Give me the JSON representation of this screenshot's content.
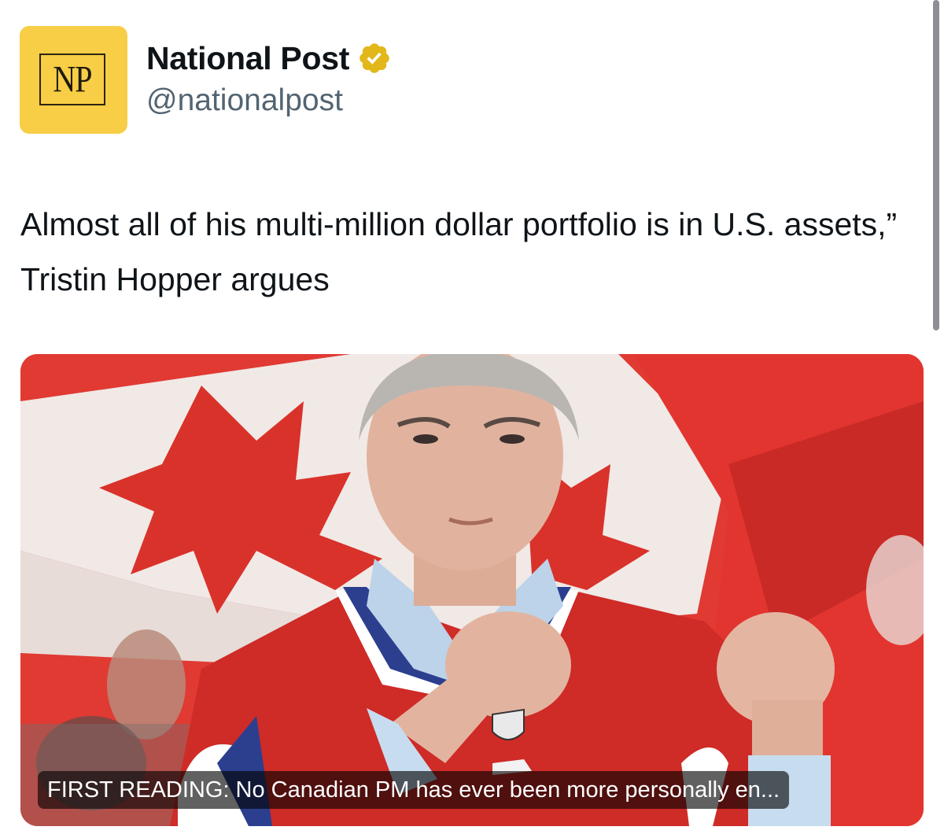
{
  "account": {
    "avatar_text": "NP",
    "display_name": "National Post",
    "handle": "@nationalpost",
    "verified": true,
    "avatar_color": "#f7ce46",
    "verified_badge_color": "#e2b719"
  },
  "tweet": {
    "text": "Almost all of his multi-million dollar portfolio is in U.S. assets,” Tristin Hopper argues"
  },
  "link_card": {
    "title": "FIRST READING: No Canadian PM has ever been more personally en...",
    "image_description_icon": "photo-icon"
  }
}
